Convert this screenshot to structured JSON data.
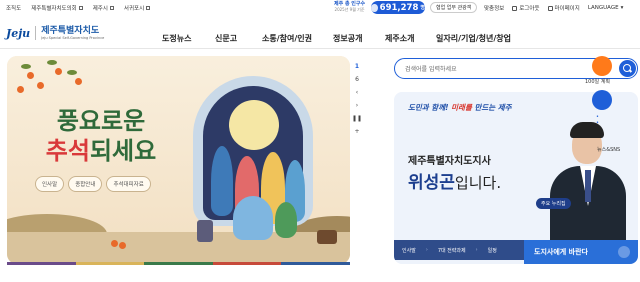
{
  "util": {
    "left_links": [
      "조직도",
      "제주특별자치도의회",
      "제주시",
      "서귀포시"
    ],
    "population_title": "제주 총 인구수",
    "population_date": "2025년 9월 기준",
    "population_value": "691,278",
    "population_unit": "명",
    "alert_button": "협업 업무 관광객",
    "right_links": [
      "맞춤정보",
      "로그아웃",
      "마이페이지",
      "LANGUAGE"
    ]
  },
  "header": {
    "logo_mark": "Jeju",
    "logo_kr": "제주특별자치도",
    "logo_en": "Jeju Special Self-Governing Province",
    "nav": [
      "도정뉴스",
      "신문고",
      "소통/참여/인권",
      "정보공개",
      "제주소개",
      "일자리/기업/청년/창업"
    ]
  },
  "hero": {
    "title_line1": "풍요로운",
    "title_line2_red": "추석",
    "title_line2_green": "되세요",
    "pills": [
      "인사말",
      "종합안내",
      "추석대피자료"
    ],
    "colors": {
      "green": "#2f6a3a",
      "red": "#d9393a"
    }
  },
  "pager": {
    "current": "1",
    "total": "6"
  },
  "search": {
    "placeholder": "검색어를 입력하세요"
  },
  "quick": {
    "label": "100일 계획",
    "sns": "뉴스&SNS"
  },
  "governor": {
    "slogan_a": "도민과 함께! ",
    "slogan_b": "미래를",
    "slogan_c": " 만드는 제주",
    "role": "제주특별자치도지사",
    "name": "위성곤",
    "name_suffix": "입니다.",
    "tag": "주요 누리집",
    "bar_items": [
      "인사말",
      "7대 전략과제",
      "일정"
    ],
    "cta": "도지사에게 바란다"
  }
}
